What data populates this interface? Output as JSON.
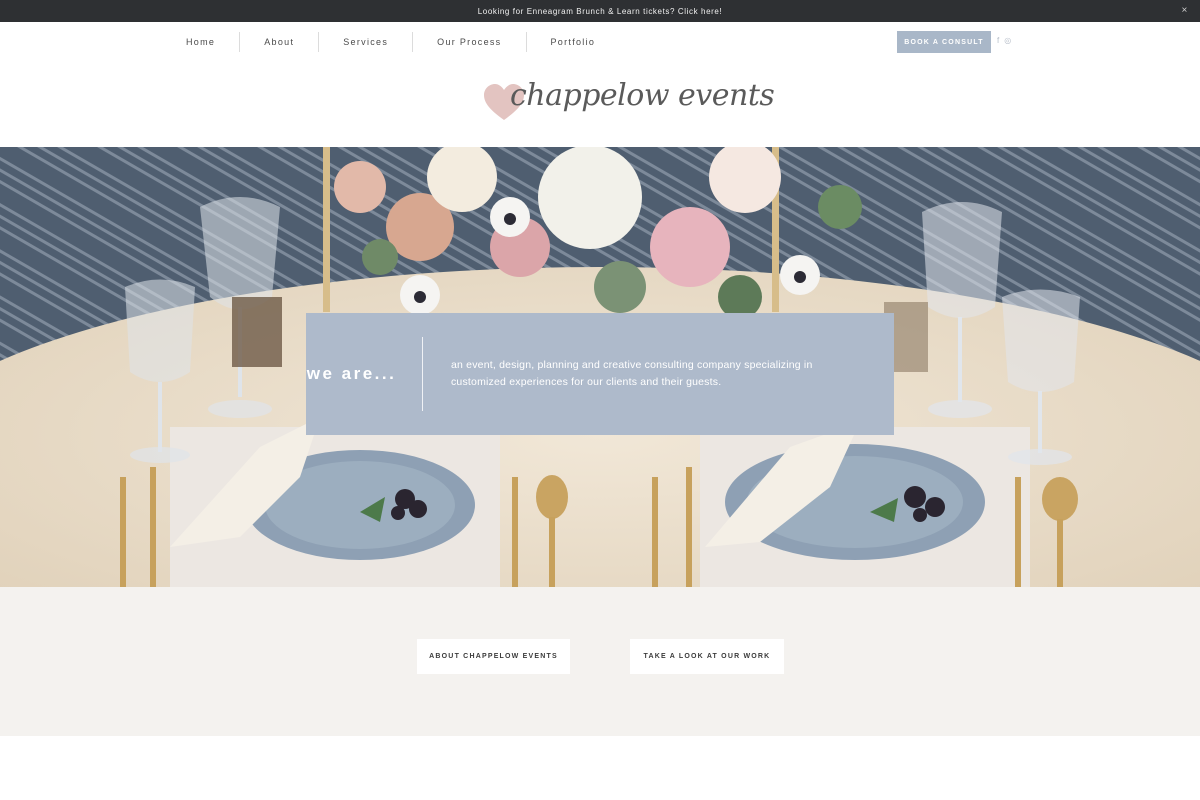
{
  "announcement": {
    "text": "Looking for Enneagram Brunch & Learn tickets? Click here!",
    "close_label": "×"
  },
  "nav": {
    "items": [
      {
        "label": "Home"
      },
      {
        "label": "About"
      },
      {
        "label": "Services"
      },
      {
        "label": "Our Process"
      },
      {
        "label": "Portfolio"
      }
    ],
    "book_label": "BOOK A CONSULT",
    "social": {
      "facebook": "f",
      "instagram": "◎"
    }
  },
  "logo": {
    "text": "chappelow events",
    "heart_color": "#e3c4c1"
  },
  "hero": {
    "title": "we are...",
    "description": "an event, design, planning and creative consulting company specializing in customized experiences for our clients and their guests.",
    "box_color": "#aebacb"
  },
  "ctas": {
    "about_label": "ABOUT CHAPPELOW EVENTS",
    "work_label": "TAKE A LOOK AT OUR WORK"
  },
  "colors": {
    "accent": "#a9b7c8",
    "dark_bar": "#2e3033",
    "lower_bg": "#f4f2ef"
  }
}
